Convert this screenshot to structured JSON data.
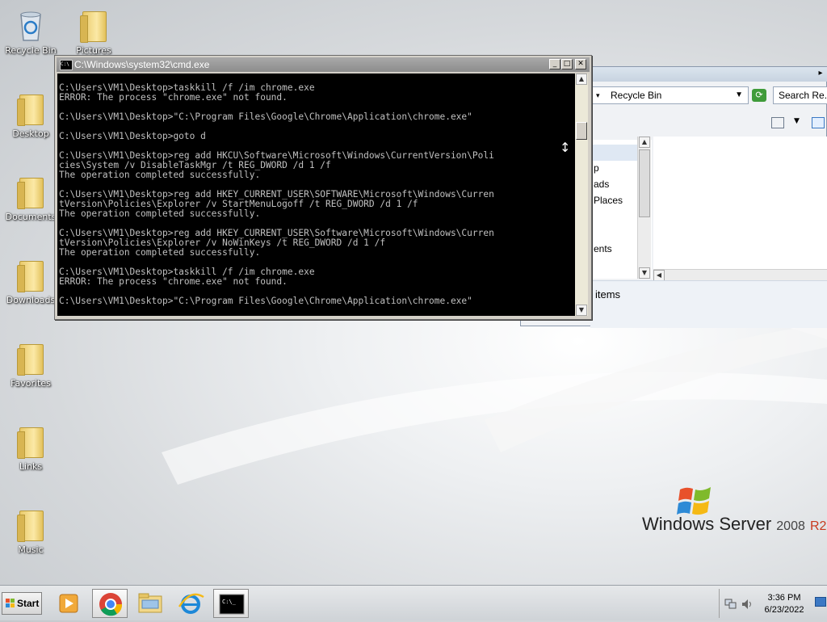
{
  "desktop": {
    "icons": [
      {
        "label": "Recycle Bin"
      },
      {
        "label": "Pictures"
      },
      {
        "label": "Desktop"
      },
      {
        "label": "Documents"
      },
      {
        "label": "Downloads"
      },
      {
        "label": "Favorites"
      },
      {
        "label": "Links"
      },
      {
        "label": "Music"
      }
    ],
    "logo": {
      "name": "Windows Server",
      "version": "2008",
      "suffix": "R2"
    }
  },
  "explorer": {
    "address": "Recycle Bin",
    "search_placeholder": "Search Re...",
    "nav_items": [
      "p",
      "ads",
      "Places",
      "ents"
    ],
    "status": "items"
  },
  "cmd": {
    "title": "C:\\Windows\\system32\\cmd.exe",
    "lines": [
      "C:\\Users\\VM1\\Desktop>taskkill /f /im chrome.exe",
      "ERROR: The process \"chrome.exe\" not found.",
      "",
      "C:\\Users\\VM1\\Desktop>\"C:\\Program Files\\Google\\Chrome\\Application\\chrome.exe\"",
      "",
      "C:\\Users\\VM1\\Desktop>goto d",
      "",
      "C:\\Users\\VM1\\Desktop>reg add HKCU\\Software\\Microsoft\\Windows\\CurrentVersion\\Poli",
      "cies\\System /v DisableTaskMgr /t REG_DWORD /d 1 /f",
      "The operation completed successfully.",
      "",
      "C:\\Users\\VM1\\Desktop>reg add HKEY_CURRENT_USER\\SOFTWARE\\Microsoft\\Windows\\Curren",
      "tVersion\\Policies\\Explorer /v StartMenuLogoff /t REG_DWORD /d 1 /f",
      "The operation completed successfully.",
      "",
      "C:\\Users\\VM1\\Desktop>reg add HKEY_CURRENT_USER\\Software\\Microsoft\\Windows\\Curren",
      "tVersion\\Policies\\Explorer /v NoWinKeys /t REG_DWORD /d 1 /f",
      "The operation completed successfully.",
      "",
      "C:\\Users\\VM1\\Desktop>taskkill /f /im chrome.exe",
      "ERROR: The process \"chrome.exe\" not found.",
      "",
      "C:\\Users\\VM1\\Desktop>\"C:\\Program Files\\Google\\Chrome\\Application\\chrome.exe\""
    ]
  },
  "taskbar": {
    "start_label": "Start",
    "time": "3:36 PM",
    "date": "6/23/2022"
  }
}
